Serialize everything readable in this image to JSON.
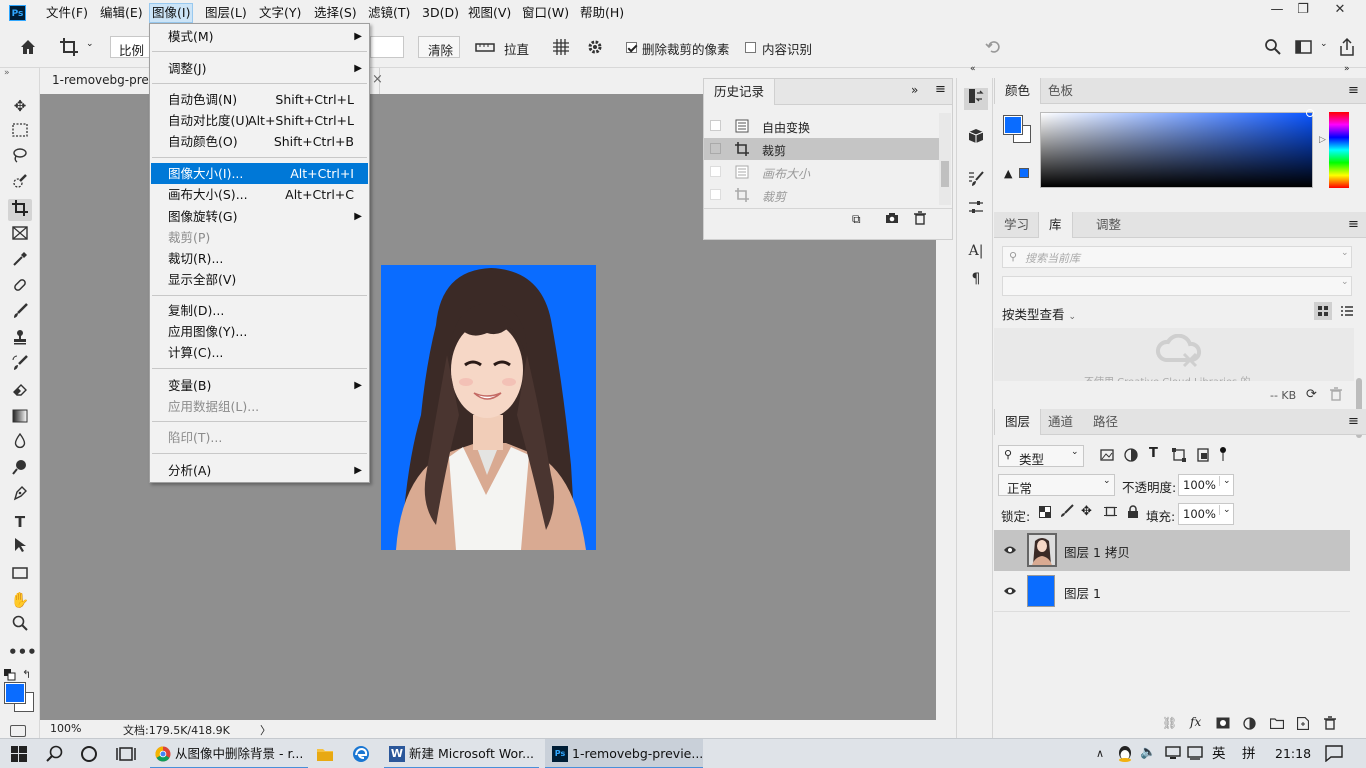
{
  "app": {
    "logo": "Ps",
    "menus": [
      "文件(F)",
      "编辑(E)",
      "图像(I)",
      "图层(L)",
      "文字(Y)",
      "选择(S)",
      "滤镜(T)",
      "3D(D)",
      "视图(V)",
      "窗口(W)",
      "帮助(H)"
    ],
    "active_menu": "图像(I)",
    "window_controls": [
      "—",
      "❐",
      "✕"
    ]
  },
  "options_bar": {
    "ratio_label": "比例",
    "clear_label": "清除",
    "straighten_label": "拉直",
    "delete_cropped_label": "删除裁剪的像素",
    "delete_cropped_checked": true,
    "content_aware_label": "内容识别",
    "content_aware_checked": false
  },
  "image_menu": {
    "items": [
      {
        "label": "模式(M)",
        "shortcut": "",
        "submenu": true,
        "disabled": false
      },
      {
        "label": "调整(J)",
        "shortcut": "",
        "submenu": true,
        "disabled": false
      },
      {
        "label": "自动色调(N)",
        "shortcut": "Shift+Ctrl+L",
        "submenu": false,
        "disabled": false
      },
      {
        "label": "自动对比度(U)",
        "shortcut": "Alt+Shift+Ctrl+L",
        "submenu": false,
        "disabled": false
      },
      {
        "label": "自动颜色(O)",
        "shortcut": "Shift+Ctrl+B",
        "submenu": false,
        "disabled": false
      },
      {
        "label": "图像大小(I)...",
        "shortcut": "Alt+Ctrl+I",
        "submenu": false,
        "disabled": false,
        "highlighted": true
      },
      {
        "label": "画布大小(S)...",
        "shortcut": "Alt+Ctrl+C",
        "submenu": false,
        "disabled": false
      },
      {
        "label": "图像旋转(G)",
        "shortcut": "",
        "submenu": true,
        "disabled": false
      },
      {
        "label": "裁剪(P)",
        "shortcut": "",
        "submenu": false,
        "disabled": true
      },
      {
        "label": "裁切(R)...",
        "shortcut": "",
        "submenu": false,
        "disabled": false
      },
      {
        "label": "显示全部(V)",
        "shortcut": "",
        "submenu": false,
        "disabled": false
      },
      {
        "label": "复制(D)...",
        "shortcut": "",
        "submenu": false,
        "disabled": false
      },
      {
        "label": "应用图像(Y)...",
        "shortcut": "",
        "submenu": false,
        "disabled": false
      },
      {
        "label": "计算(C)...",
        "shortcut": "",
        "submenu": false,
        "disabled": false
      },
      {
        "label": "变量(B)",
        "shortcut": "",
        "submenu": true,
        "disabled": false
      },
      {
        "label": "应用数据组(L)...",
        "shortcut": "",
        "submenu": false,
        "disabled": true
      },
      {
        "label": "陷印(T)...",
        "shortcut": "",
        "submenu": false,
        "disabled": true
      },
      {
        "label": "分析(A)",
        "shortcut": "",
        "submenu": true,
        "disabled": false
      }
    ]
  },
  "document": {
    "tab_title": "1-removebg-previ",
    "tab_close": "×",
    "zoom": "100%",
    "doc_info": "文档:179.5K/418.9K",
    "status_arrow": "〉"
  },
  "history": {
    "title": "历史记录",
    "items": [
      {
        "label": "自由变换",
        "state": "normal"
      },
      {
        "label": "裁剪",
        "state": "selected"
      },
      {
        "label": "画布大小",
        "state": "undone"
      },
      {
        "label": "裁剪",
        "state": "undone"
      }
    ]
  },
  "color_panel": {
    "tabs": [
      "颜色",
      "色板"
    ],
    "foreground": "#0a6cff",
    "background": "#ffffff"
  },
  "library_panel": {
    "tabs": [
      "学习",
      "库",
      "调整"
    ],
    "search_placeholder": "搜索当前库",
    "view_by_label": "按类型查看",
    "cc_message": "不使用 Creative Cloud Libraries 的...",
    "size_label": "-- KB"
  },
  "layers_panel": {
    "tabs": [
      "图层",
      "通道",
      "路径"
    ],
    "filter_kind": "类型",
    "blend_mode": "正常",
    "opacity_label": "不透明度:",
    "opacity_value": "100%",
    "lock_label": "锁定:",
    "fill_label": "填充:",
    "fill_value": "100%",
    "layers": [
      {
        "name": "图层 1 拷贝",
        "selected": true
      },
      {
        "name": "图层 1",
        "selected": false
      }
    ]
  },
  "taskbar": {
    "items": [
      "从图像中删除背景 - r...",
      "新建 Microsoft Wor...",
      "1-removebg-previe..."
    ],
    "ime": "英",
    "ime2": "拼",
    "time": "21:18"
  }
}
